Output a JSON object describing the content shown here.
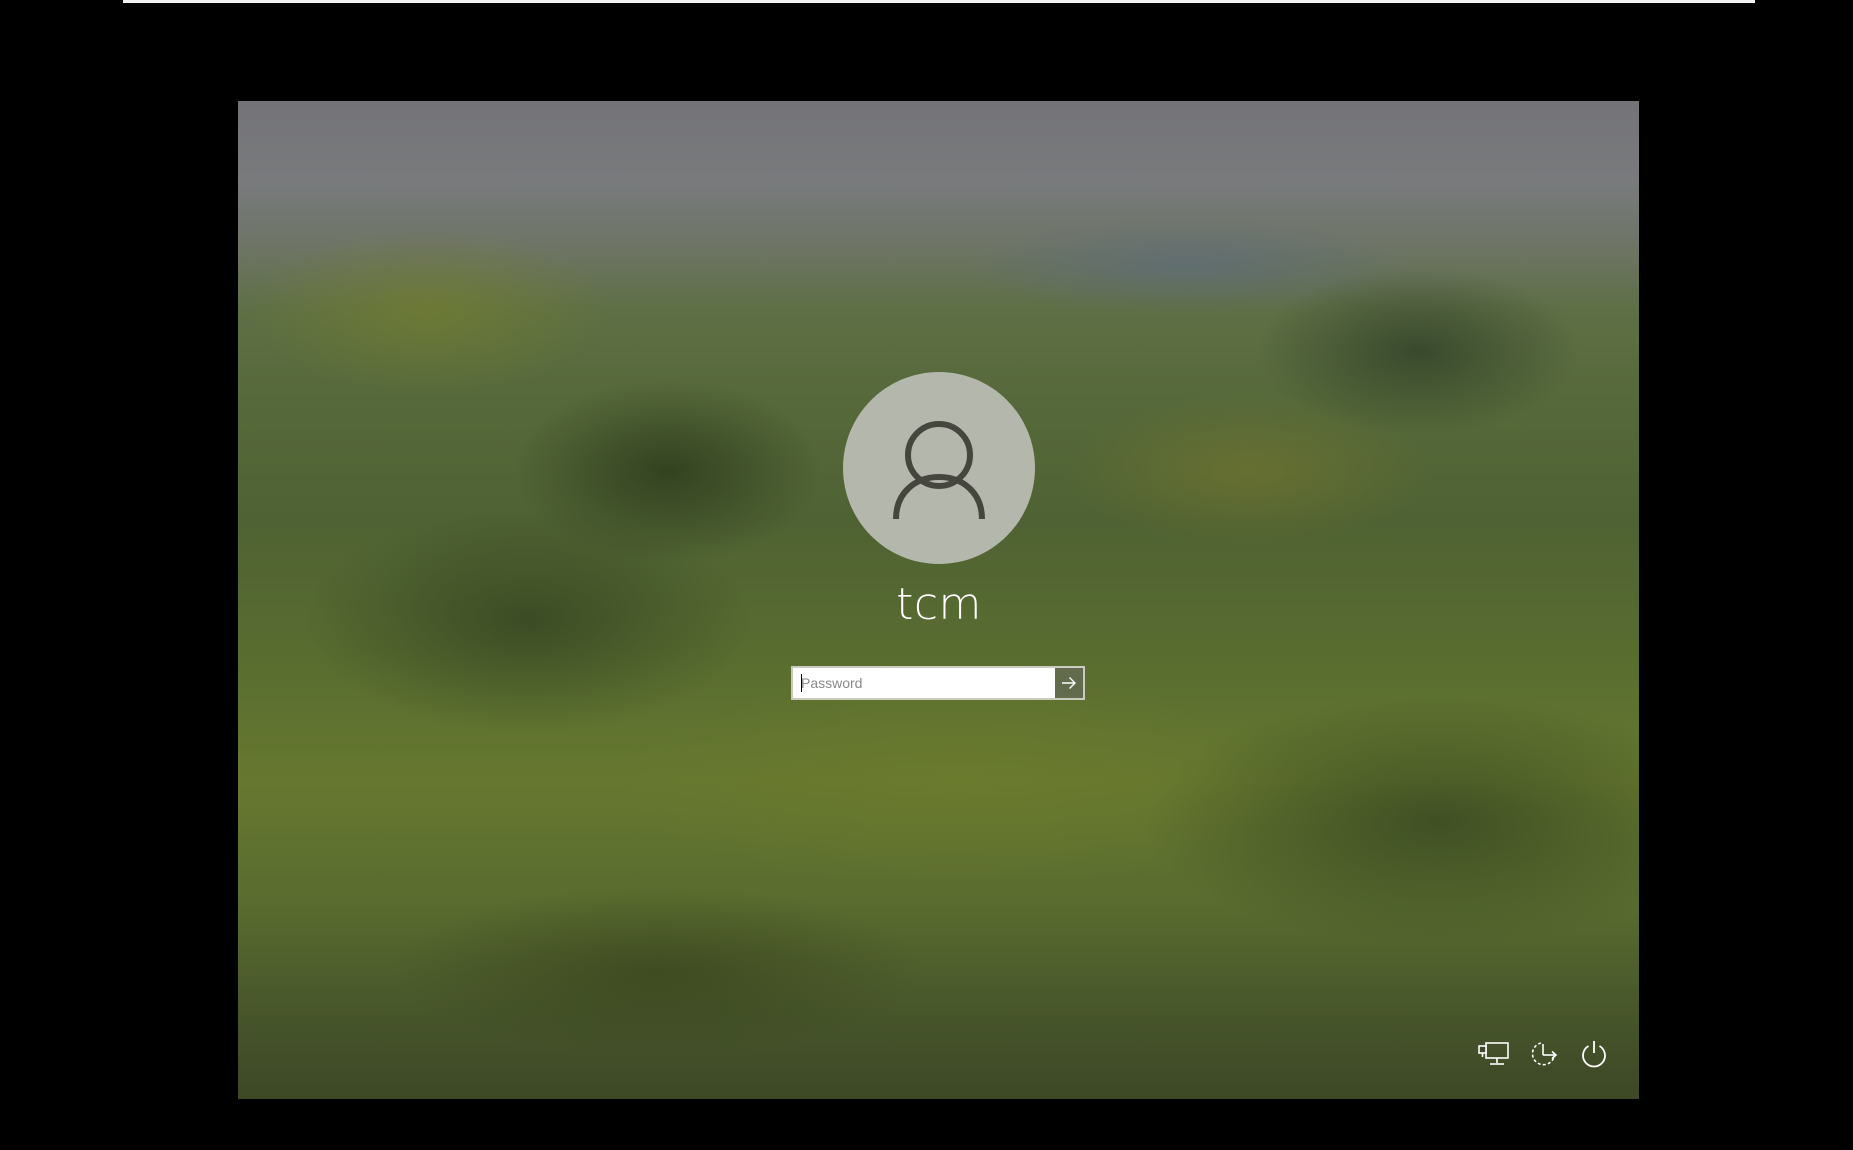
{
  "login": {
    "username": "tcm",
    "password_placeholder": "Password",
    "password_value": ""
  },
  "icons": {
    "avatar": "user-silhouette-icon",
    "submit": "arrow-right-icon",
    "network": "network-icon",
    "ease_of_access": "ease-of-access-icon",
    "power": "power-icon"
  },
  "colors": {
    "outer_background": "#000000",
    "avatar_circle": "#b4b7ab",
    "submit_button": "#626b4c",
    "text": "#ffffff"
  }
}
